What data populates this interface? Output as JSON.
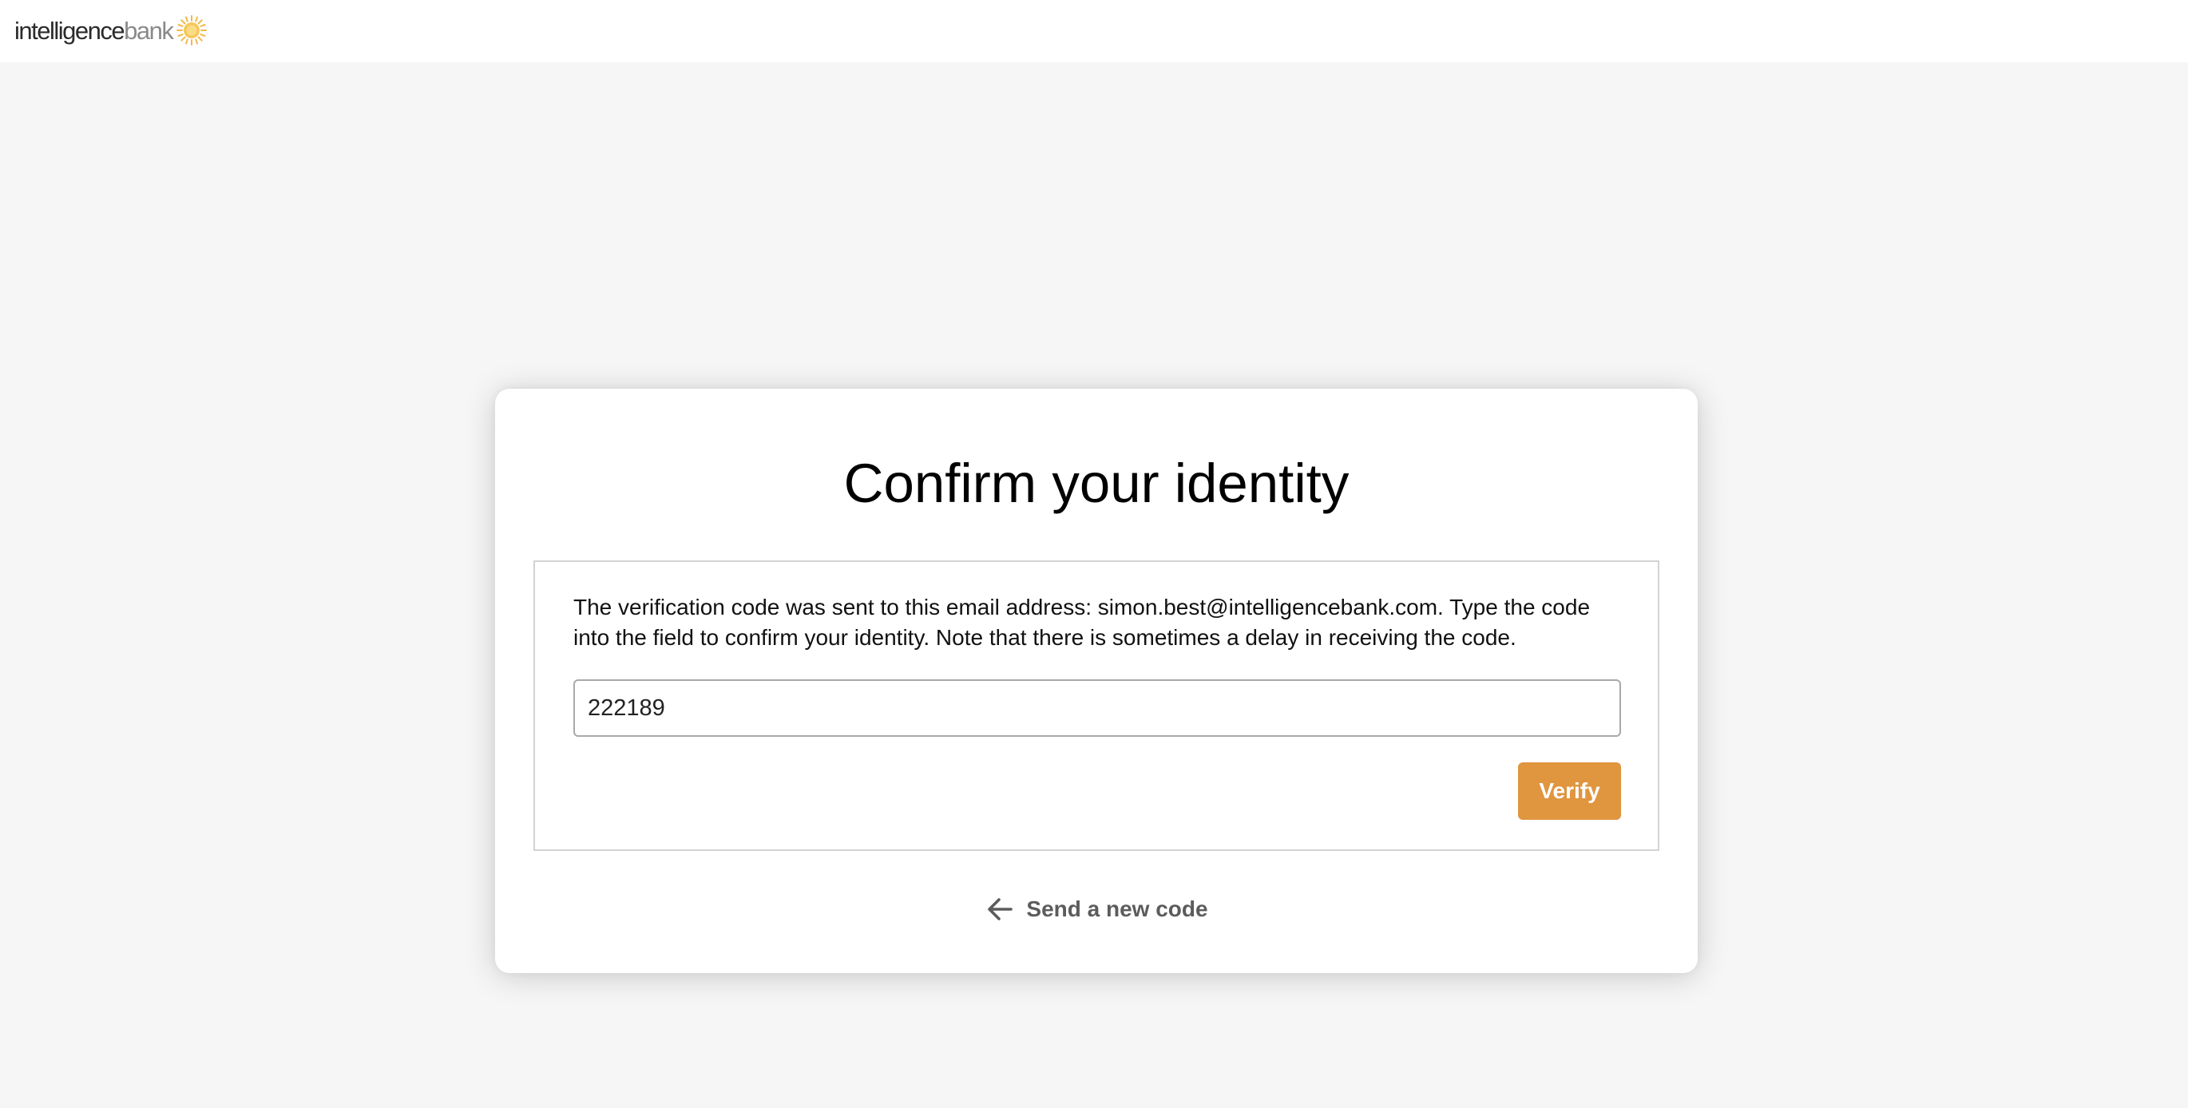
{
  "header": {
    "logo_word_1": "intelligence",
    "logo_word_2": "bank",
    "logo_icon": "sun-icon"
  },
  "card": {
    "title": "Confirm your identity",
    "instructions": "The verification code was sent to this email address: simon.best@intelligencebank.com. Type the code into the field to confirm your identity. Note that there is sometimes a delay in receiving the code.",
    "code_input": {
      "value": "222189",
      "placeholder": ""
    },
    "verify_label": "Verify",
    "resend_label": "Send a new code",
    "resend_icon": "arrow-left-icon"
  },
  "colors": {
    "accent": "#e0953f",
    "background": "#f6f6f6",
    "card": "#ffffff",
    "link": "#5c5c5c"
  }
}
